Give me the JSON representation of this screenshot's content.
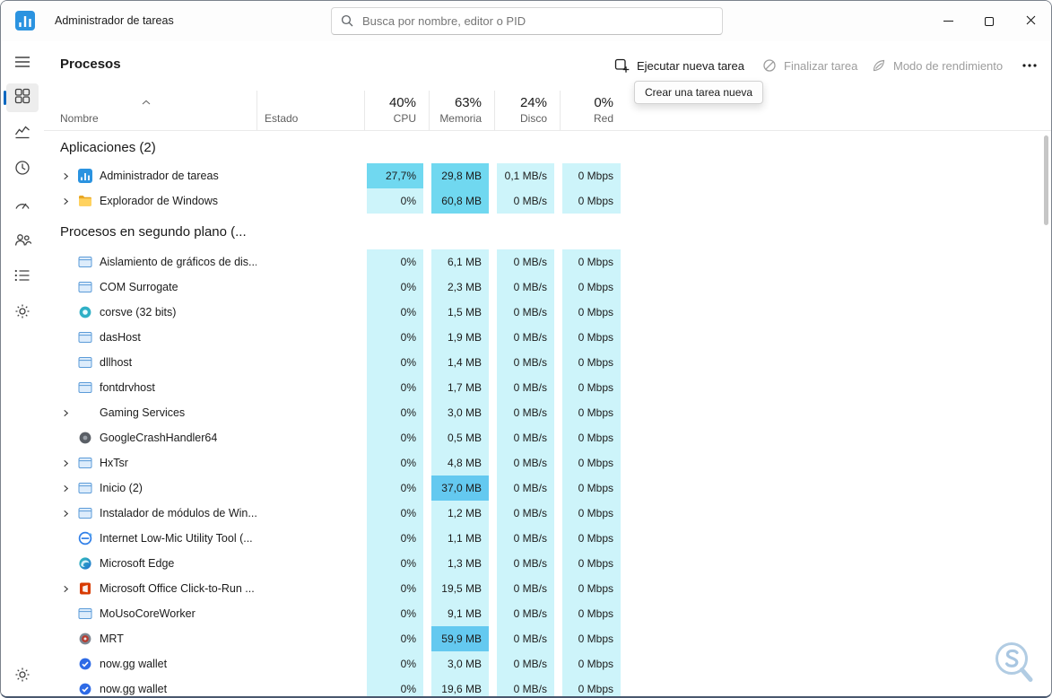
{
  "colors": {
    "accent": "#0067c0",
    "cell_light": "#cdf4fa",
    "cell_mid": "#70d8f0",
    "cell_high": "#64c9f0"
  },
  "titlebar": {
    "app_title": "Administrador de tareas",
    "search_placeholder": "Busca por nombre, editor o PID"
  },
  "sidebar": {
    "items": [
      {
        "id": "menu"
      },
      {
        "id": "processes",
        "selected": true
      },
      {
        "id": "performance"
      },
      {
        "id": "app-history"
      },
      {
        "id": "startup-apps"
      },
      {
        "id": "users"
      },
      {
        "id": "details"
      },
      {
        "id": "services"
      },
      {
        "id": "settings"
      }
    ]
  },
  "header": {
    "title": "Procesos",
    "actions": {
      "run_new_task": "Ejecutar nueva tarea",
      "end_task": "Finalizar tarea",
      "performance_mode": "Modo de rendimiento"
    },
    "tooltip": "Crear una tarea nueva"
  },
  "table": {
    "columns": [
      {
        "top": "",
        "label": "Nombre"
      },
      {
        "top": "",
        "label": "Estado"
      },
      {
        "top": "40%",
        "label": "CPU"
      },
      {
        "top": "63%",
        "label": "Memoria"
      },
      {
        "top": "24%",
        "label": "Disco"
      },
      {
        "top": "0%",
        "label": "Red"
      }
    ],
    "groups": [
      {
        "label": "Aplicaciones (2)",
        "rows": [
          {
            "name": "Administrador de tareas",
            "icon": "taskmgr",
            "chevron": true,
            "values": [
              "27,7%",
              "29,8 MB",
              "0,1 MB/s",
              "0 Mbps"
            ],
            "shades": [
              "mid",
              "mid",
              "light",
              "light"
            ]
          },
          {
            "name": "Explorador de Windows",
            "icon": "folder",
            "chevron": true,
            "values": [
              "0%",
              "60,8 MB",
              "0 MB/s",
              "0 Mbps"
            ],
            "shades": [
              "light",
              "mid",
              "light",
              "light"
            ]
          }
        ]
      },
      {
        "label": "Procesos en segundo plano (...",
        "rows": [
          {
            "name": "Aislamiento de gráficos de dis...",
            "icon": "window",
            "chevron": false,
            "values": [
              "0%",
              "6,1 MB",
              "0 MB/s",
              "0 Mbps"
            ],
            "shades": [
              "light",
              "light",
              "light",
              "light"
            ]
          },
          {
            "name": "COM Surrogate",
            "icon": "window",
            "chevron": false,
            "values": [
              "0%",
              "2,3 MB",
              "0 MB/s",
              "0 Mbps"
            ],
            "shades": [
              "light",
              "light",
              "light",
              "light"
            ]
          },
          {
            "name": "corsve (32 bits)",
            "icon": "teal",
            "chevron": false,
            "values": [
              "0%",
              "1,5 MB",
              "0 MB/s",
              "0 Mbps"
            ],
            "shades": [
              "light",
              "light",
              "light",
              "light"
            ]
          },
          {
            "name": "dasHost",
            "icon": "window",
            "chevron": false,
            "values": [
              "0%",
              "1,9 MB",
              "0 MB/s",
              "0 Mbps"
            ],
            "shades": [
              "light",
              "light",
              "light",
              "light"
            ]
          },
          {
            "name": "dllhost",
            "icon": "window",
            "chevron": false,
            "values": [
              "0%",
              "1,4 MB",
              "0 MB/s",
              "0 Mbps"
            ],
            "shades": [
              "light",
              "light",
              "light",
              "light"
            ]
          },
          {
            "name": "fontdrvhost",
            "icon": "window",
            "chevron": false,
            "values": [
              "0%",
              "1,7 MB",
              "0 MB/s",
              "0 Mbps"
            ],
            "shades": [
              "light",
              "light",
              "light",
              "light"
            ]
          },
          {
            "name": "Gaming Services",
            "icon": "none",
            "chevron": true,
            "values": [
              "0%",
              "3,0 MB",
              "0 MB/s",
              "0 Mbps"
            ],
            "shades": [
              "light",
              "light",
              "light",
              "light"
            ]
          },
          {
            "name": "GoogleCrashHandler64",
            "icon": "darkball",
            "chevron": false,
            "values": [
              "0%",
              "0,5 MB",
              "0 MB/s",
              "0 Mbps"
            ],
            "shades": [
              "light",
              "light",
              "light",
              "light"
            ]
          },
          {
            "name": "HxTsr",
            "icon": "window",
            "chevron": true,
            "values": [
              "0%",
              "4,8 MB",
              "0 MB/s",
              "0 Mbps"
            ],
            "shades": [
              "light",
              "light",
              "light",
              "light"
            ]
          },
          {
            "name": "Inicio (2)",
            "icon": "window",
            "chevron": true,
            "values": [
              "0%",
              "37,0 MB",
              "0 MB/s",
              "0 Mbps"
            ],
            "shades": [
              "light",
              "high",
              "light",
              "light"
            ]
          },
          {
            "name": "Instalador de módulos de Win...",
            "icon": "window",
            "chevron": true,
            "values": [
              "0%",
              "1,2 MB",
              "0 MB/s",
              "0 Mbps"
            ],
            "shades": [
              "light",
              "light",
              "light",
              "light"
            ]
          },
          {
            "name": "Internet Low-Mic Utility Tool (...",
            "icon": "ie",
            "chevron": false,
            "values": [
              "0%",
              "1,1 MB",
              "0 MB/s",
              "0 Mbps"
            ],
            "shades": [
              "light",
              "light",
              "light",
              "light"
            ]
          },
          {
            "name": "Microsoft Edge",
            "icon": "edge",
            "chevron": false,
            "values": [
              "0%",
              "1,3 MB",
              "0 MB/s",
              "0 Mbps"
            ],
            "shades": [
              "light",
              "light",
              "light",
              "light"
            ]
          },
          {
            "name": "Microsoft Office Click-to-Run ...",
            "icon": "office",
            "chevron": true,
            "values": [
              "0%",
              "19,5 MB",
              "0 MB/s",
              "0 Mbps"
            ],
            "shades": [
              "light",
              "light",
              "light",
              "light"
            ]
          },
          {
            "name": "MoUsoCoreWorker",
            "icon": "window",
            "chevron": false,
            "values": [
              "0%",
              "9,1 MB",
              "0 MB/s",
              "0 Mbps"
            ],
            "shades": [
              "light",
              "light",
              "light",
              "light"
            ]
          },
          {
            "name": "MRT",
            "icon": "mrt",
            "chevron": false,
            "values": [
              "0%",
              "59,9 MB",
              "0 MB/s",
              "0 Mbps"
            ],
            "shades": [
              "light",
              "high",
              "light",
              "light"
            ]
          },
          {
            "name": "now.gg wallet",
            "icon": "wallet",
            "chevron": false,
            "values": [
              "0%",
              "3,0 MB",
              "0 MB/s",
              "0 Mbps"
            ],
            "shades": [
              "light",
              "light",
              "light",
              "light"
            ]
          },
          {
            "name": "now.gg wallet",
            "icon": "wallet",
            "chevron": false,
            "values": [
              "0%",
              "19,6 MB",
              "0 MB/s",
              "0 Mbps"
            ],
            "shades": [
              "light",
              "light",
              "light",
              "light"
            ]
          }
        ]
      }
    ]
  }
}
